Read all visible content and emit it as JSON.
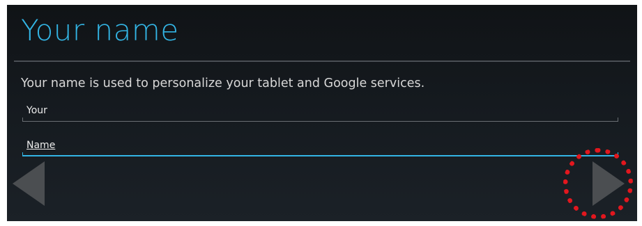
{
  "page": {
    "title": "Your name",
    "description": "Your name is used to personalize your tablet and Google services."
  },
  "form": {
    "first_name": {
      "value": "Your"
    },
    "last_name": {
      "value": "Name"
    }
  },
  "nav": {
    "back_icon": "triangle-left-icon",
    "next_icon": "triangle-right-icon"
  },
  "colors": {
    "title": "#33b5e5",
    "focused_underline": "#33b5e5",
    "arrow": "#4b4e51",
    "highlight": "#e2171e"
  }
}
